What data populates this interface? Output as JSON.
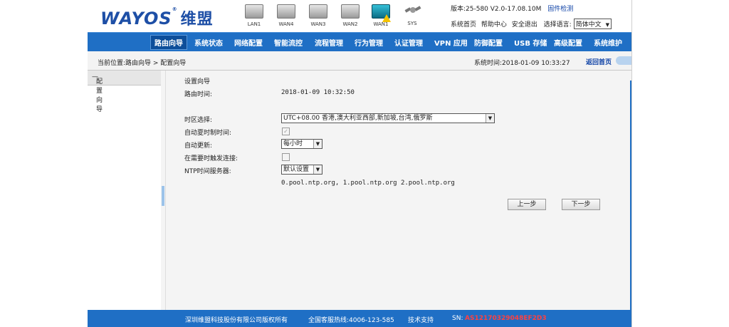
{
  "header": {
    "logo_text": "WAYOS",
    "logo_cn": "维盟",
    "logo_tm": "®",
    "ports": [
      "LAN1",
      "WAN4",
      "WAN3",
      "WAN2",
      "WAN1",
      "SYS"
    ],
    "version_label": "版本:25-580 V2.0-17.08.10M",
    "upgrade_link": "固件检测",
    "links": [
      "系统首页",
      "帮助中心",
      "安全退出"
    ],
    "lang_label": "选择语言:",
    "lang_value": "简体中文"
  },
  "nav": {
    "items": [
      "路由向导",
      "系统状态",
      "网络配置",
      "智能流控",
      "流程管理",
      "行为管理",
      "认证管理",
      "VPN 应用",
      "防御配置",
      "USB 存储",
      "高级配置",
      "系统维护"
    ]
  },
  "subbar": {
    "crumb": "当前位置:路由向导 > 配置向导",
    "time": "系统时间:2018-01-09 10:33:27",
    "back": "返回首页"
  },
  "sidebar": {
    "items": [
      "配置向导"
    ]
  },
  "form": {
    "section_title": "设置向导",
    "router_time_label": "路由时间:",
    "router_time_value": "2018-01-09 10:32:50",
    "timezone_label": "时区选择:",
    "timezone_value": "UTC+08.00  香港,澳大利亚西部,新加坡,台湾,俄罗斯",
    "auto_sync_label": "自动夏时制时间:",
    "auto_update_label": "自动更新:",
    "auto_update_value": "每小时",
    "on_demand_label": "在需要时触发连接:",
    "ntp_label": "NTP时间服务器:",
    "ntp_value": "默认设置",
    "ntp_servers": "0.pool.ntp.org, 1.pool.ntp.org 2.pool.ntp.org",
    "prev_button": "上一步",
    "next_button": "下一步"
  },
  "footer": {
    "company": "深圳维盟科技股份有限公司版权所有",
    "hotline": "全国客服热线:4006-123-585",
    "support": "技术支持",
    "sn_label": "SN:",
    "sn_value": "AS12170329048EF2D3"
  },
  "colors": {
    "nav_blue": "#1f6fc5",
    "logo_blue": "#1e4fa6",
    "sn_red": "#ff4040"
  }
}
